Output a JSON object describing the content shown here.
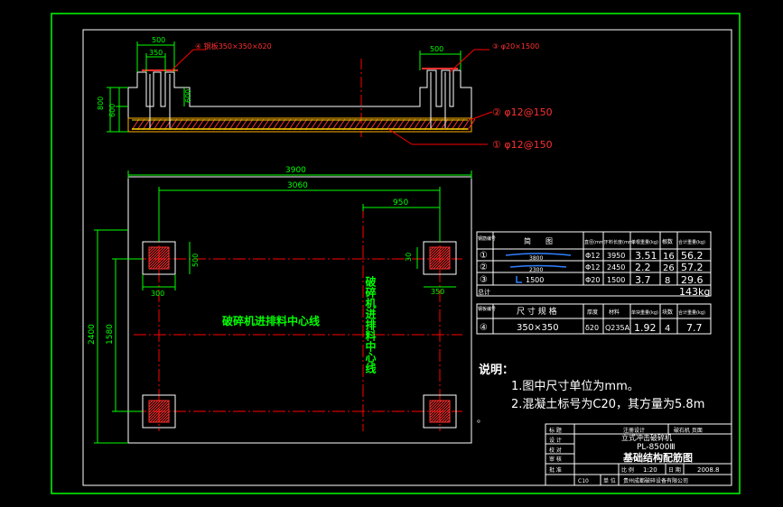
{
  "colors": {
    "background": "#000000",
    "frame_outer": "#00ff00",
    "frame_inner": "#ffffff",
    "centerline": "#ff0000",
    "dimension": "#00ff00",
    "leader": "#ff0000",
    "annotation": "#ff0000",
    "hatch": "#ff3030",
    "rebar": "#ffd700",
    "slab": "#ffb000",
    "rebar_shape": "#3080ff",
    "center_label": "#00ff00",
    "notes": "#ffffff",
    "table_border": "#ffffff"
  },
  "section_view": {
    "dim_top_left": "500",
    "dim_top_left_inner": "350",
    "dim_top_right": "500",
    "dim_height_outer": "800",
    "dim_height_inner": "600",
    "dim_pocket_depth": "600",
    "callout_4": "④ 钢板350×350×δ20",
    "callout_3": "③ φ20×1500",
    "callout_2": "② φ12@150",
    "callout_1": "① φ12@150"
  },
  "plan_view": {
    "dim_width_outer": "3900",
    "dim_width_inner": "3060",
    "dim_offset_right": "950",
    "dim_height_outer": "2400",
    "dim_height_inner": "1580",
    "dim_pocket": "500",
    "dim_pocket_offset": "300",
    "dim_pocket_right": "350",
    "dim_pocket_small": "30",
    "label_horizontal": "破碎机进排料中心线",
    "label_vertical": "破碎机进排料中心线"
  },
  "rebar_table": {
    "headers": [
      "钢筋编号",
      "简　　图",
      "直径(mm)",
      "下料长度(mm)",
      "单根重量(kg)",
      "根数",
      "合计重量(kg)"
    ],
    "rows": [
      {
        "no": "①",
        "shape": "3800",
        "dia": "Φ12",
        "length": "3950",
        "unit": "3.51",
        "count": "16",
        "total": "56.2"
      },
      {
        "no": "②",
        "shape": "2300",
        "dia": "Φ12",
        "length": "2450",
        "unit": "2.2",
        "count": "26",
        "total": "57.2"
      },
      {
        "no": "③",
        "shape": "1500",
        "dia": "Φ20",
        "length": "1500",
        "unit": "3.7",
        "count": "8",
        "total": "29.6"
      }
    ],
    "total_label": "总计",
    "total_value": "143kg"
  },
  "plate_table": {
    "headers": [
      "钢板编号",
      "尺 寸 规 格",
      "厚度",
      "材料",
      "单块重量(kg)",
      "块数",
      "合计重量(kg)"
    ],
    "row": {
      "no": "④",
      "size": "350×350",
      "thickness": "δ20",
      "material": "Q235A",
      "unit": "1.92",
      "count": "4",
      "total": "7.7"
    }
  },
  "notes": {
    "title": "说明：",
    "line1": "1.图中尺寸单位为mm。",
    "line2": "2.混凝土标号为C20，其方量为5.8m",
    "line2_tail": "。"
  },
  "title_block": {
    "r1c1": "标 题",
    "r1c2": "注册设计",
    "r1c3": "破石机 页面",
    "r2c1": "设 计",
    "r2c2": "立式冲击破碎机",
    "r3c1": "校 对",
    "r3c2": "PL-8500Ⅲ",
    "r4c1": "审 核",
    "r4c2": "基础结构配筋图",
    "r5c1": "批 准",
    "r5c2": "比 例",
    "r5c3": "1:20",
    "r5c4": "日 期",
    "r5c5": "2008.8",
    "r6c1": "C10",
    "r6c2": "单 位",
    "r6c3": "贵州成都破碎设备有限公司"
  }
}
